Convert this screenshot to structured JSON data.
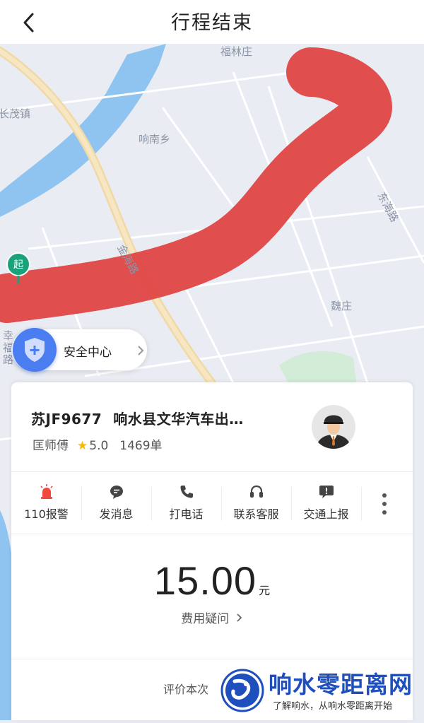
{
  "header": {
    "title": "行程结束"
  },
  "map": {
    "labels": {
      "fulin": "福林庄",
      "changmao": "长茂镇",
      "xiangnan": "响南乡",
      "jinhai": "金海路",
      "donghai": "东海路",
      "weizhuang": "魏庄",
      "xing": "幸福路"
    },
    "start_label": "起"
  },
  "safety_center": {
    "label": "安全中心"
  },
  "driver_card": {
    "plate": "苏JF9677",
    "company": "响水县文华汽车出…",
    "driver_name": "匡师傅",
    "rating": "5.0",
    "orders": "1469单"
  },
  "actions": [
    {
      "label": "110报警",
      "icon": "alarm-icon"
    },
    {
      "label": "发消息",
      "icon": "message-icon"
    },
    {
      "label": "打电话",
      "icon": "phone-icon"
    },
    {
      "label": "联系客服",
      "icon": "headset-icon"
    },
    {
      "label": "交通上报",
      "icon": "report-icon"
    }
  ],
  "fare": {
    "amount": "15.00",
    "unit": "元",
    "question": "费用疑问"
  },
  "rate_prompt": "评价本次",
  "watermark": {
    "title": "响水零距离网",
    "subtitle": "了解响水，从响水零距离开始"
  },
  "colors": {
    "accent": "#4a7df0",
    "route_overlay": "#e04848",
    "start_pin": "#1aa37a",
    "alarm": "#f04a3e",
    "watermark": "#1e4fbd"
  }
}
